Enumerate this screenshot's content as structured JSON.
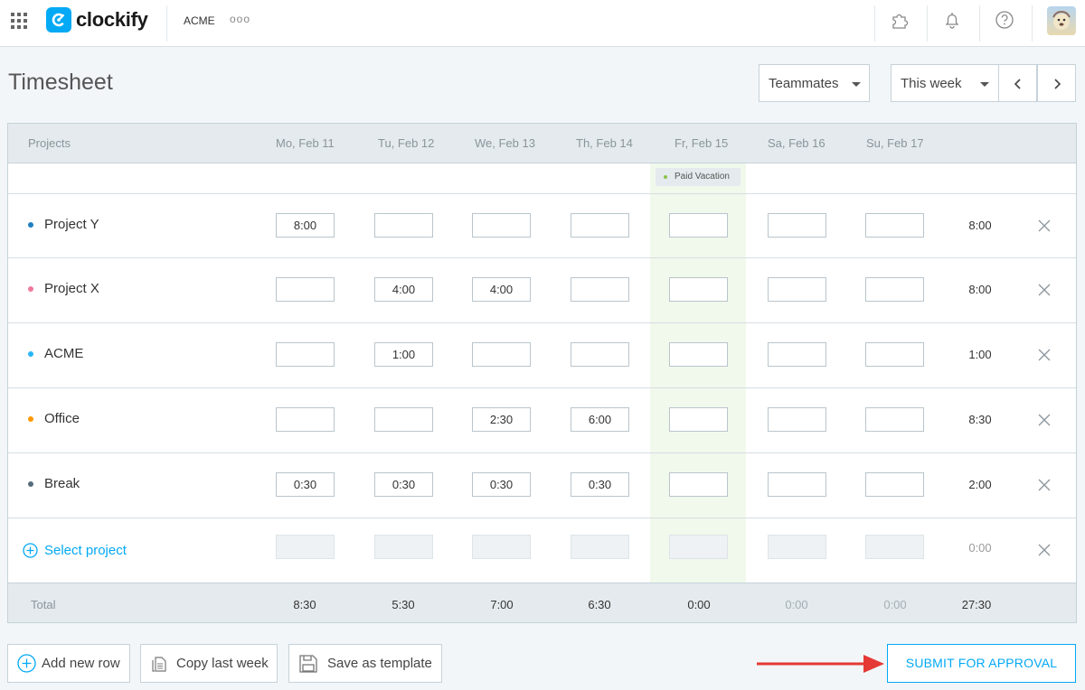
{
  "app": {
    "name": "clockify",
    "workspace": "ACME",
    "workspace_menu": "ooo"
  },
  "page": {
    "title": "Timesheet",
    "teammates_label": "Teammates",
    "period_label": "This week"
  },
  "table": {
    "projects_header": "Projects",
    "days": [
      "Mo, Feb 11",
      "Tu, Feb 12",
      "We, Feb 13",
      "Th, Feb 14",
      "Fr, Feb 15",
      "Sa, Feb 16",
      "Su, Feb 17"
    ],
    "vacation_label": "Paid Vacation",
    "rows": [
      {
        "name": "Project Y",
        "color": "#1e7fc1",
        "cells": [
          "8:00",
          "",
          "",
          "",
          "",
          "",
          ""
        ],
        "total": "8:00"
      },
      {
        "name": "Project X",
        "color": "#f0789a",
        "cells": [
          "",
          "4:00",
          "4:00",
          "",
          "",
          "",
          ""
        ],
        "total": "8:00"
      },
      {
        "name": "ACME",
        "color": "#29b6f6",
        "cells": [
          "",
          "1:00",
          "",
          "",
          "",
          "",
          ""
        ],
        "total": "1:00"
      },
      {
        "name": "Office",
        "color": "#ff9800",
        "cells": [
          "",
          "",
          "2:30",
          "6:00",
          "",
          "",
          ""
        ],
        "total": "8:30"
      },
      {
        "name": "Break",
        "color": "#546e7a",
        "cells": [
          "0:30",
          "0:30",
          "0:30",
          "0:30",
          "",
          "",
          ""
        ],
        "total": "2:00"
      }
    ],
    "select_project_label": "Select project",
    "select_project_total": "0:00",
    "footer": {
      "label": "Total",
      "day_totals": [
        "8:30",
        "5:30",
        "7:00",
        "6:30",
        "0:00",
        "0:00",
        "0:00"
      ],
      "grand_total": "27:30"
    }
  },
  "actions": {
    "add_row": "Add new row",
    "copy_week": "Copy last week",
    "save_template": "Save as template",
    "submit": "SUBMIT FOR APPROVAL"
  },
  "colors": {
    "accent": "#03a9f4",
    "arrow": "#e53935",
    "vacation_band": "#f1f8ec"
  }
}
